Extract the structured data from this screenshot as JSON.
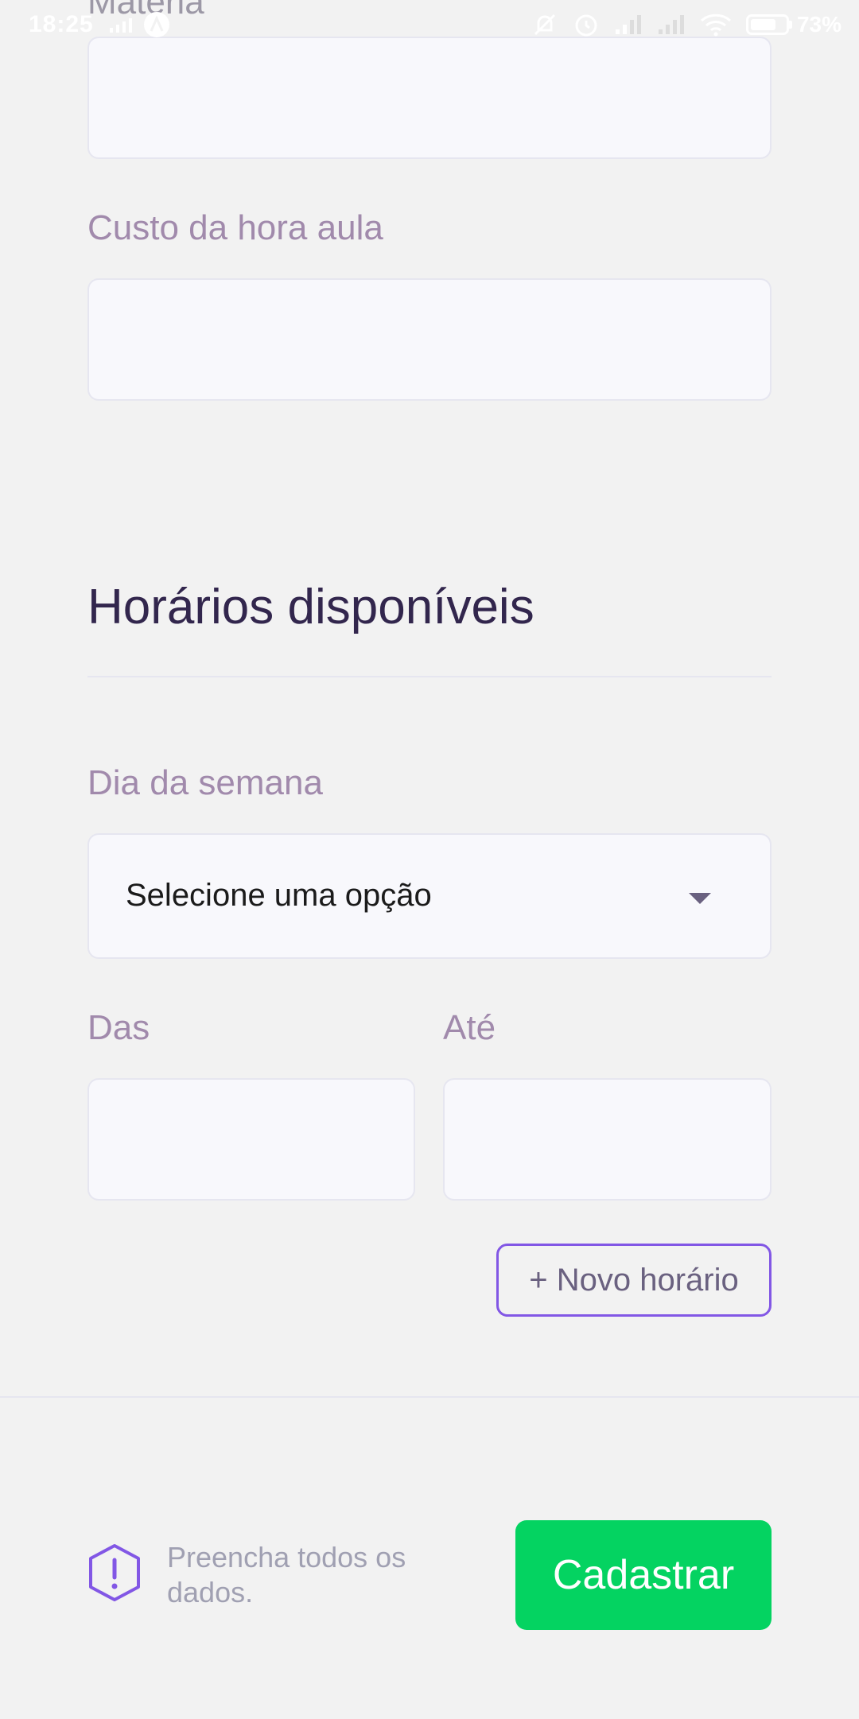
{
  "status_bar": {
    "time": "18:25",
    "battery_percent": "73",
    "battery_level": 0.73,
    "icons": [
      "signal-left-icon",
      "app-notification-icon",
      "bell-muted-icon",
      "alarm-icon",
      "signal-icon",
      "signal-icon",
      "wifi-icon",
      "battery-icon"
    ]
  },
  "form": {
    "subject_label_clipped": "Matéria",
    "cost_label": "Custo da hora aula",
    "cost_value": ""
  },
  "schedule_section": {
    "title": "Horários disponíveis",
    "weekday_label": "Dia da semana",
    "weekday_selected": "Selecione uma opção",
    "from_label": "Das",
    "to_label": "Até",
    "add_button_label": "+ Novo horário"
  },
  "footer": {
    "warning_text": "Preencha todos os dados.",
    "submit_label": "Cadastrar"
  },
  "colors": {
    "accent_purple": "#8257e5",
    "submit_green": "#04d361",
    "label_color": "#a18aac",
    "title_color": "#32264d"
  }
}
